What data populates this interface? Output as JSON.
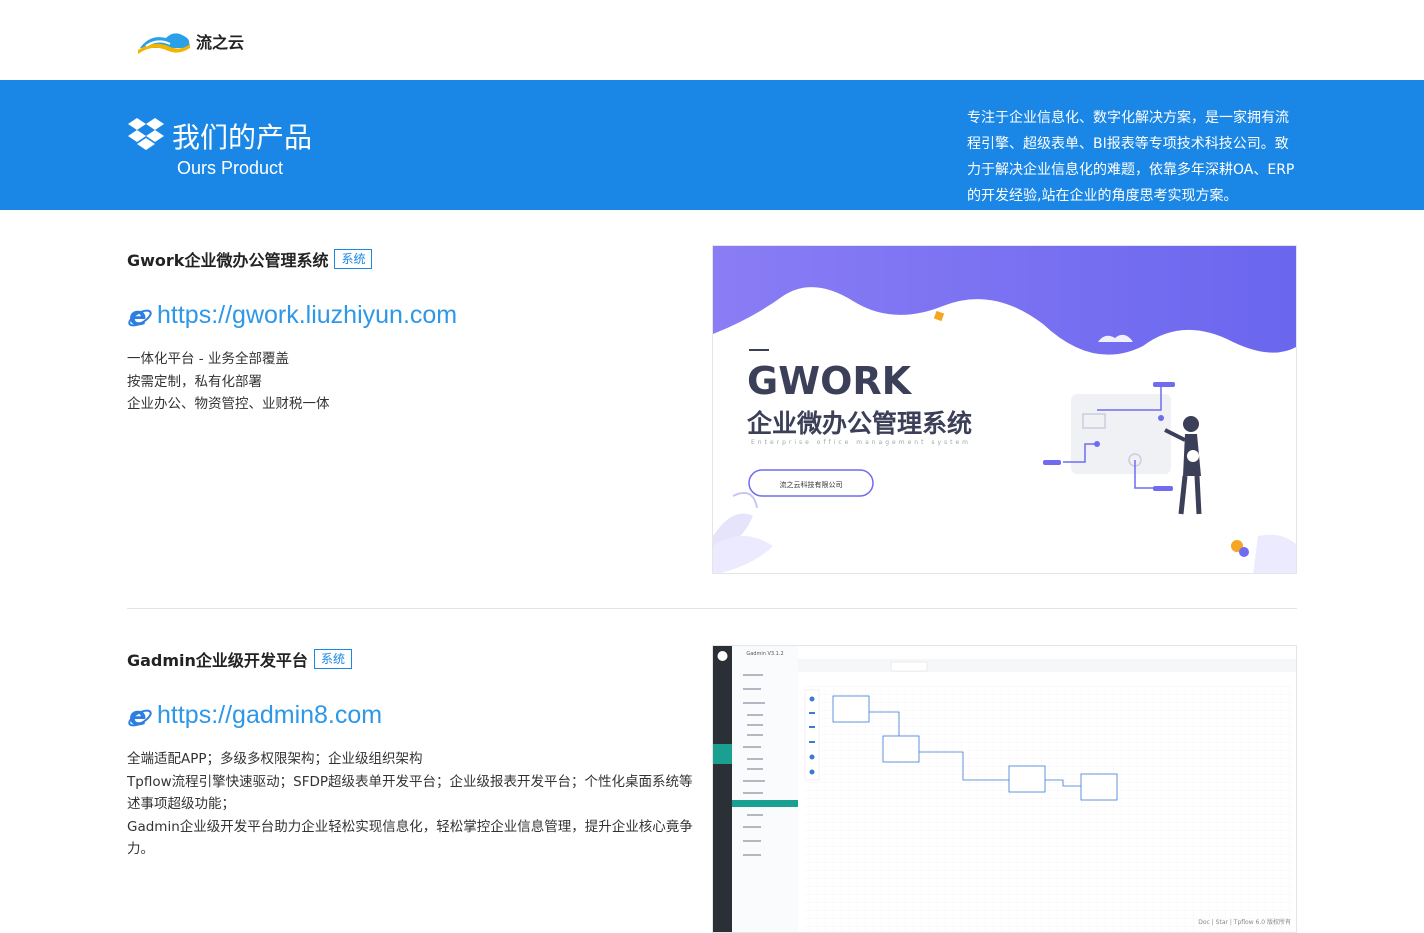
{
  "header": {
    "logo_text": "流之云"
  },
  "banner": {
    "title": "我们的产品",
    "subtitle": "Ours Product",
    "description": "专注于企业信息化、数字化解决方案，是一家拥有流程引擎、超级表单、BI报表等专项技术科技公司。致力于解决企业信息化的难题，依靠多年深耕OA、ERP的开发经验,站在企业的角度思考实现方案。"
  },
  "products": [
    {
      "name": "Gwork企业微办公管理系统",
      "tag": "系统",
      "url": "https://gwork.liuzhiyun.com",
      "lines": [
        "一体化平台 - 业务全部覆盖",
        "按需定制，私有化部署",
        "企业办公、物资管控、业财税一体"
      ],
      "image": {
        "title": "GWORK",
        "subtitle": "企业微办公管理系统",
        "tagline": "Enterprise office management system",
        "company_button": "流之云科技有限公司"
      }
    },
    {
      "name": "Gadmin企业级开发平台",
      "tag": "系统",
      "url": "https://gadmin8.com",
      "lines": [
        "全端适配APP；多级多权限架构；企业级组织架构",
        "Tpflow流程引擎快速驱动；SFDP超级表单开发平台；企业级报表开发平台；个性化桌面系统等述事项超级功能；",
        "Gadmin企业级开发平台助力企业轻松实现信息化，轻松掌控企业信息管理，提升企业核心竟争力。"
      ],
      "image": {
        "app_title": "Gadmin V3.1.2",
        "footer": "Doc | Star | Tpflow 6.0 版权所有"
      }
    }
  ],
  "colors": {
    "banner": "#1a87e6",
    "link": "#2d97e8",
    "purple": "#6f6cf0"
  }
}
